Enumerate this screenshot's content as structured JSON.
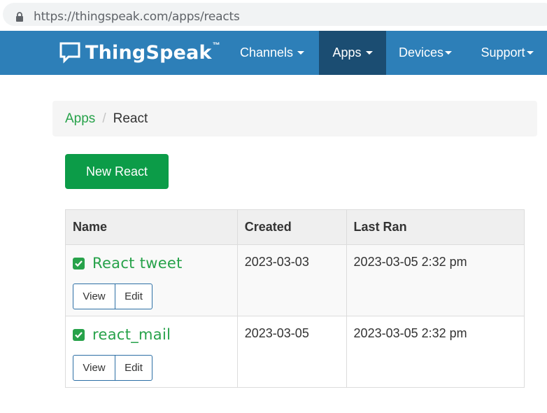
{
  "browser": {
    "url_domain": "https://thingspeak.com",
    "url_path": "/apps/reacts"
  },
  "navbar": {
    "brand": "ThingSpeak",
    "brand_tm": "™",
    "items": [
      {
        "label": "Channels",
        "active": false
      },
      {
        "label": "Apps",
        "active": true
      },
      {
        "label": "Devices",
        "active": false
      },
      {
        "label": "Support",
        "active": false
      }
    ]
  },
  "breadcrumb": {
    "parent": "Apps",
    "separator": "/",
    "current": "React"
  },
  "actions": {
    "new_react": "New React"
  },
  "table": {
    "headers": {
      "name": "Name",
      "created": "Created",
      "last_ran": "Last Ran"
    },
    "rows": [
      {
        "name": "React tweet",
        "created": "2023-03-03",
        "last_ran": "2023-03-05 2:32 pm",
        "view": "View",
        "edit": "Edit",
        "enabled": true
      },
      {
        "name": "react_mail",
        "created": "2023-03-05",
        "last_ran": "2023-03-05 2:32 pm",
        "view": "View",
        "edit": "Edit",
        "enabled": true
      }
    ]
  },
  "colors": {
    "navbar": "#2d7fb8",
    "navbar_active": "#1b4d72",
    "accent_green": "#27a24a",
    "button_green": "#0c9c48"
  }
}
